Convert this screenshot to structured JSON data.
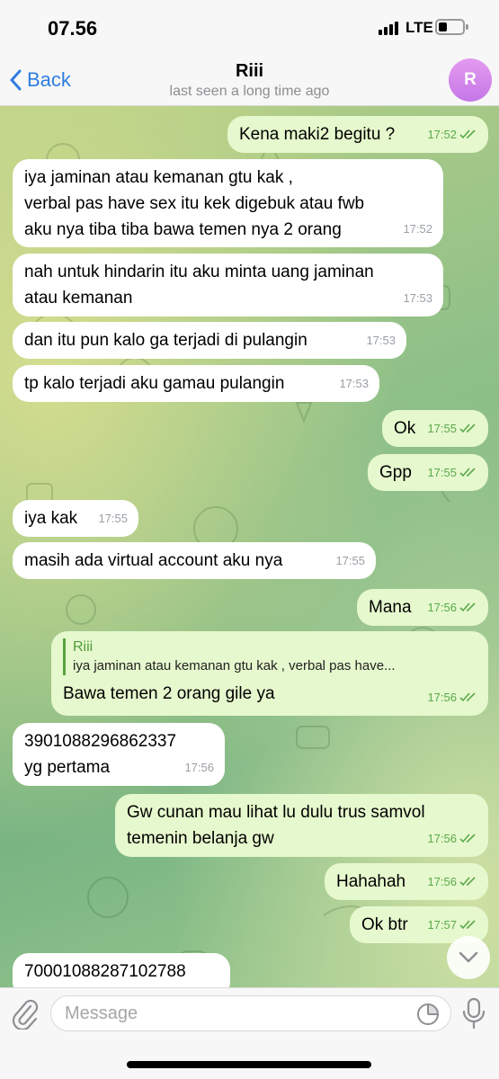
{
  "status": {
    "time": "07.56",
    "network": "LTE"
  },
  "header": {
    "back_label": "Back",
    "title": "Riii",
    "subtitle": "last seen a long time ago",
    "avatar_initial": "R"
  },
  "messages": [
    {
      "dir": "out",
      "text": "Kena maki2 begitu ?",
      "time": "17:52"
    },
    {
      "dir": "in",
      "text": "iya jaminan atau kemanan gtu kak ,\nverbal pas have sex itu kek digebuk atau fwb\naku nya tiba tiba bawa temen nya 2 orang",
      "time": "17:52"
    },
    {
      "dir": "in",
      "text": "nah untuk hindarin itu aku minta uang jaminan\natau kemanan",
      "time": "17:53"
    },
    {
      "dir": "in",
      "text": "dan itu pun kalo ga terjadi di pulangin",
      "time": "17:53"
    },
    {
      "dir": "in",
      "text": "tp kalo terjadi aku gamau pulangin",
      "time": "17:53"
    },
    {
      "dir": "out",
      "text": "Ok",
      "time": "17:55"
    },
    {
      "dir": "out",
      "text": "Gpp",
      "time": "17:55"
    },
    {
      "dir": "in",
      "text": "iya kak",
      "time": "17:55"
    },
    {
      "dir": "in",
      "text": "masih ada virtual account aku nya",
      "time": "17:55"
    },
    {
      "dir": "out",
      "text": "Mana",
      "time": "17:56"
    },
    {
      "dir": "out",
      "text": "Bawa temen 2 orang gile ya",
      "time": "17:56",
      "reply": {
        "name": "Riii",
        "text": "iya jaminan atau kemanan gtu kak ,  verbal pas have..."
      }
    },
    {
      "dir": "in",
      "text": "3901088296862337\nyg pertama",
      "time": "17:56"
    },
    {
      "dir": "out",
      "text": "Gw cunan mau lihat lu dulu trus samvol\ntemenin belanja gw",
      "time": "17:56"
    },
    {
      "dir": "out",
      "text": "Hahahah",
      "time": "17:56"
    },
    {
      "dir": "out",
      "text": "Ok btr",
      "time": "17:57"
    },
    {
      "dir": "in",
      "text": "70001088287102788",
      "time": ""
    }
  ],
  "composer": {
    "placeholder": "Message"
  },
  "icons": {
    "back": "chevron-left-icon",
    "attach": "paperclip-icon",
    "sticker": "sticker-icon",
    "mic": "microphone-icon",
    "scroll": "chevron-down-icon",
    "read": "double-check-icon"
  },
  "colors": {
    "accent": "#2f7de1",
    "outgoing_bubble": "#e6f8cd",
    "incoming_bubble": "#ffffff",
    "check": "#5aa94c"
  }
}
